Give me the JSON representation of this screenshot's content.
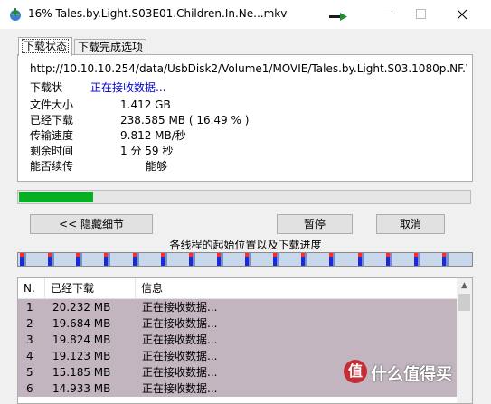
{
  "window": {
    "title": "16% Tales.by.Light.S03E01.Children.In.Ne...mkv"
  },
  "tabs": [
    {
      "label": "下载状态"
    },
    {
      "label": "下载完成选项"
    }
  ],
  "details": {
    "url": "http://10.10.10.254/data/UsbDisk2/Volume1/MOVIE/Tales.by.Light.S03.1080p.NF.W",
    "status_label": "下载状",
    "status_value": "正在接收数据...",
    "file_size_label": "文件大小",
    "file_size_value": "1.412  GB",
    "downloaded_label": "已经下载",
    "downloaded_value": "238.585  MB  ( 16.49 % )",
    "speed_label": "传输速度",
    "speed_value": "9.812  MB/秒",
    "remaining_label": "剩余时间",
    "remaining_value": "1 分 59 秒",
    "resume_label": "能否续传",
    "resume_value": "能够"
  },
  "progress": {
    "fraction": 0.1649,
    "color": "#06b025"
  },
  "buttons": {
    "hide_details": "<< 隐藏细节",
    "pause": "暂停",
    "cancel": "取消"
  },
  "threads": {
    "caption": "各线程的起始位置以及下载进度",
    "count": 16
  },
  "list": {
    "headers": {
      "n": "N.",
      "downloaded": "已经下载",
      "info": "信息"
    },
    "rows": [
      {
        "n": "1",
        "size": "20.232 MB",
        "info": "正在接收数据..."
      },
      {
        "n": "2",
        "size": "19.684 MB",
        "info": "正在接收数据..."
      },
      {
        "n": "3",
        "size": "19.824 MB",
        "info": "正在接收数据..."
      },
      {
        "n": "4",
        "size": "19.123 MB",
        "info": "正在接收数据..."
      },
      {
        "n": "5",
        "size": "15.185 MB",
        "info": "正在接收数据..."
      },
      {
        "n": "6",
        "size": "14.933 MB",
        "info": "正在接收数据..."
      }
    ]
  },
  "watermark": {
    "icon_text": "值",
    "text": "什么值得买"
  }
}
